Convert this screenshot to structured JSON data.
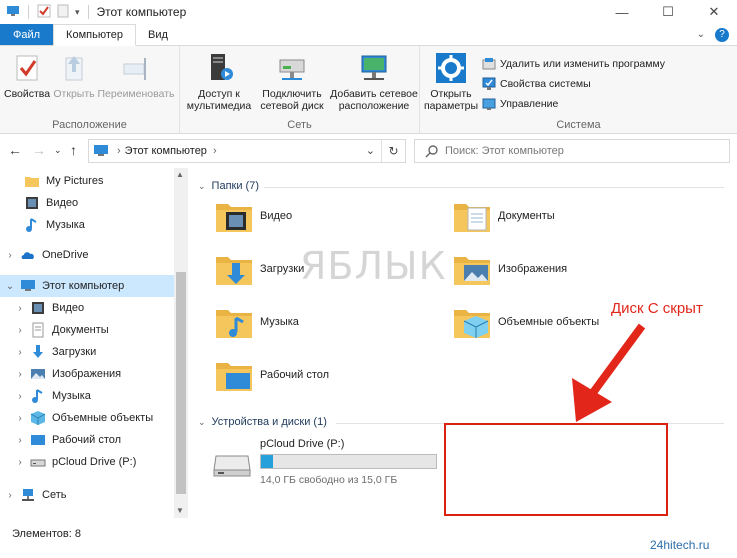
{
  "window": {
    "title": "Этот компьютер",
    "minimize": "—",
    "maximize": "☐",
    "close": "✕"
  },
  "ribbon_tabs": [
    {
      "label": "Файл"
    },
    {
      "label": "Компьютер"
    },
    {
      "label": "Вид"
    }
  ],
  "ribbon": {
    "location": {
      "label": "Расположение",
      "buttons": [
        {
          "label": "Свойства",
          "icon": "checkmark-properties-icon"
        },
        {
          "label": "Открыть",
          "icon": "open-icon"
        },
        {
          "label": "Переименовать",
          "icon": "rename-icon"
        }
      ]
    },
    "network": {
      "label": "Сеть",
      "buttons": [
        {
          "label": "Доступ к\nмультимедиа",
          "icon": "media-server-icon"
        },
        {
          "label": "Подключить\nсетевой диск",
          "icon": "network-drive-icon"
        },
        {
          "label": "Добавить сетевое\nрасположение",
          "icon": "network-location-icon"
        }
      ]
    },
    "system": {
      "label": "Система",
      "open_settings": "Открыть\nпараметры",
      "items": [
        {
          "label": "Удалить или изменить программу",
          "icon": "uninstall-icon"
        },
        {
          "label": "Свойства системы",
          "icon": "system-properties-icon"
        },
        {
          "label": "Управление",
          "icon": "manage-icon"
        }
      ]
    }
  },
  "address": {
    "path": "Этот компьютер",
    "search_placeholder": "Поиск: Этот компьютер"
  },
  "sidebar": {
    "items": [
      {
        "label": "My Pictures",
        "icon": "folder-icon"
      },
      {
        "label": "Видео",
        "icon": "video-folder-icon"
      },
      {
        "label": "Музыка",
        "icon": "music-icon"
      },
      {
        "label": "OneDrive",
        "icon": "cloud-icon"
      },
      {
        "label": "Этот компьютер",
        "icon": "computer-icon"
      },
      {
        "label": "Видео",
        "icon": "video-folder-icon"
      },
      {
        "label": "Документы",
        "icon": "documents-icon"
      },
      {
        "label": "Загрузки",
        "icon": "downloads-icon"
      },
      {
        "label": "Изображения",
        "icon": "pictures-icon"
      },
      {
        "label": "Музыка",
        "icon": "music-icon"
      },
      {
        "label": "Объемные объекты",
        "icon": "3d-objects-icon"
      },
      {
        "label": "Рабочий стол",
        "icon": "desktop-icon"
      },
      {
        "label": "pCloud Drive (P:)",
        "icon": "drive-icon"
      },
      {
        "label": "Сеть",
        "icon": "network-icon"
      }
    ]
  },
  "folders": {
    "header": "Папки (7)",
    "items": [
      {
        "label": "Видео",
        "icon": "video-folder-icon"
      },
      {
        "label": "Документы",
        "icon": "documents-folder-icon"
      },
      {
        "label": "Загрузки",
        "icon": "downloads-folder-icon"
      },
      {
        "label": "Изображения",
        "icon": "pictures-folder-icon"
      },
      {
        "label": "Музыка",
        "icon": "music-folder-icon"
      },
      {
        "label": "Объемные объекты",
        "icon": "3d-objects-folder-icon"
      },
      {
        "label": "Рабочий стол",
        "icon": "desktop-folder-icon"
      }
    ]
  },
  "devices": {
    "header": "Устройства и диски (1)",
    "drive_name": "pCloud Drive (P:)",
    "drive_free": "14,0 ГБ свободно из 15,0 ГБ",
    "used_fraction": 0.067
  },
  "annotation": {
    "text": "Диск С скрыт",
    "color": "#e3261a"
  },
  "watermark": "ЯБЛЫК",
  "status": {
    "count": "Элементов: 8",
    "site": "24hitech.ru"
  },
  "colors": {
    "accent": "#1979ca",
    "selection": "#cce8ff",
    "drive_bar": "#26a0da",
    "folder": "#f5c65b"
  }
}
